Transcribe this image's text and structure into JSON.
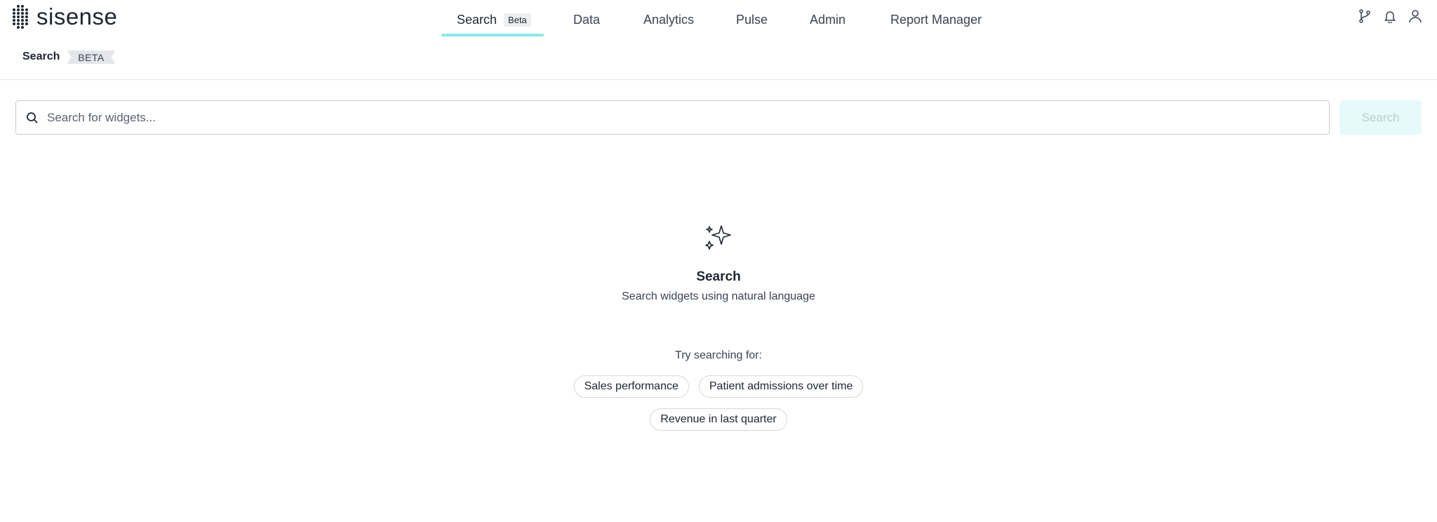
{
  "brand": {
    "name": "sisense"
  },
  "nav": {
    "items": [
      {
        "label": "Search",
        "badge": "Beta",
        "active": true
      },
      {
        "label": "Data"
      },
      {
        "label": "Analytics"
      },
      {
        "label": "Pulse"
      },
      {
        "label": "Admin"
      },
      {
        "label": "Report Manager"
      }
    ]
  },
  "topbar_icons": [
    "git-branch-icon",
    "bell-icon",
    "user-icon"
  ],
  "subheader": {
    "title": "Search",
    "tag": "BETA"
  },
  "search": {
    "placeholder": "Search for widgets...",
    "value": "",
    "button_label": "Search"
  },
  "empty_state": {
    "icon": "sparkle-icon",
    "title": "Search",
    "subtitle": "Search widgets using natural language",
    "try_label": "Try searching for:",
    "suggestions": [
      "Sales performance",
      "Patient admissions over time",
      "Revenue in last quarter"
    ]
  },
  "colors": {
    "accent": "#8ae8e9",
    "button_disabled_bg": "#e6fafa",
    "text": "#1f2532"
  }
}
